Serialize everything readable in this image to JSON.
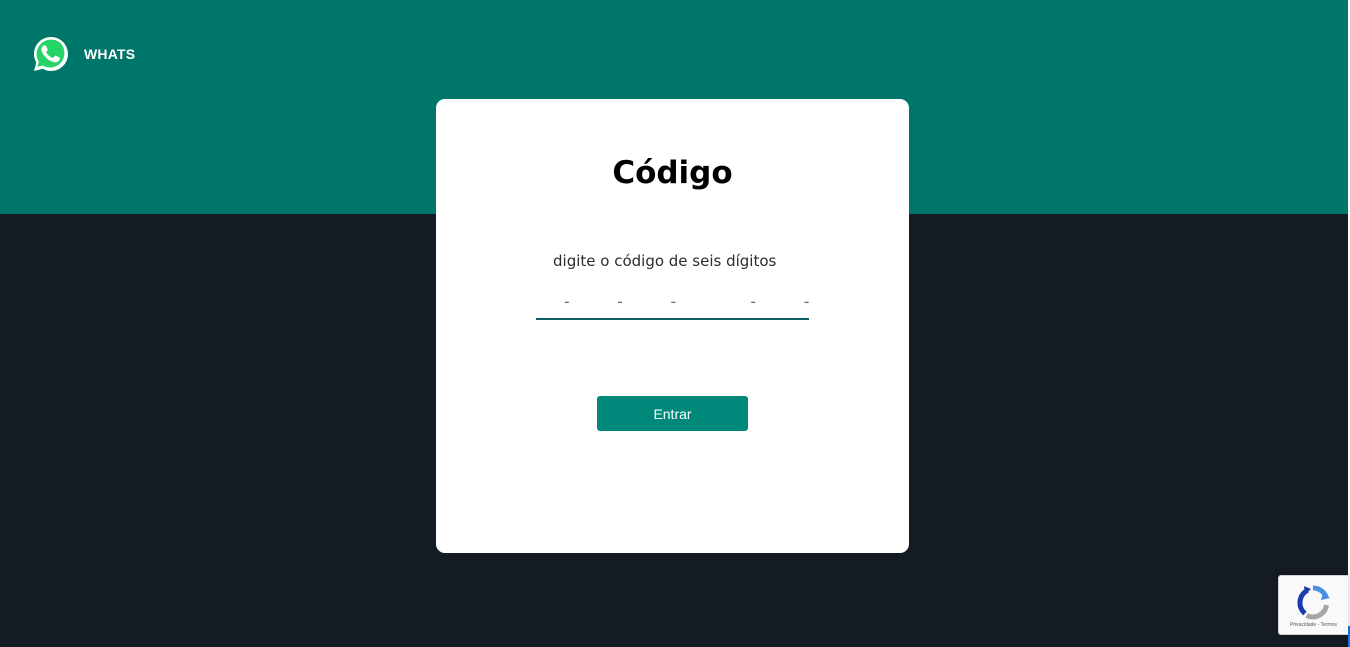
{
  "brand": {
    "name": "WHATS",
    "logo_icon": "whatsapp-icon"
  },
  "card": {
    "title": "Código",
    "code_label": "digite o código de seis dígitos",
    "code_placeholder": "- - -  - - -",
    "code_value": "",
    "submit_label": "Entrar"
  },
  "recaptcha": {
    "icon": "recaptcha-icon",
    "links": "Privacidade - Termos"
  },
  "colors": {
    "header": "#00766a",
    "background": "#141b22",
    "button": "#00897b",
    "input_underline": "#0e5f66",
    "whatsapp_green": "#25d366"
  }
}
